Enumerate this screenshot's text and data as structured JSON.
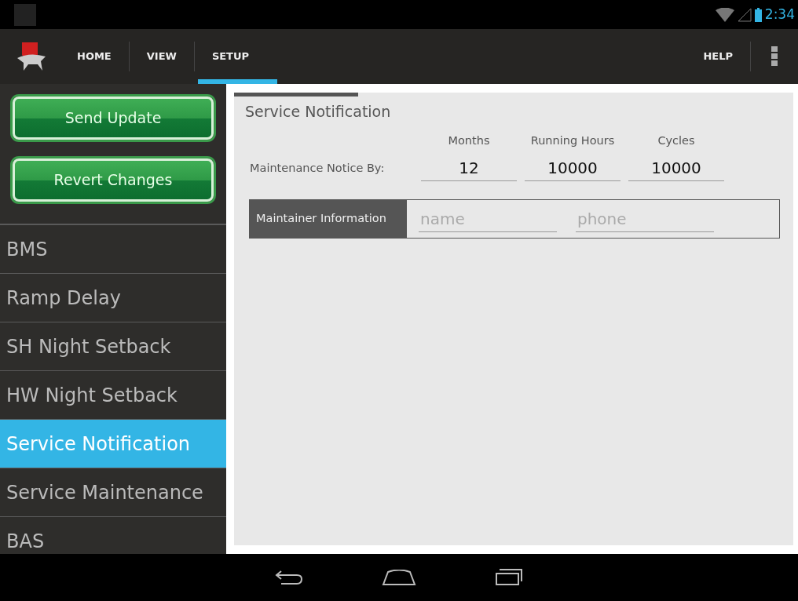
{
  "status_bar": {
    "time": "2:34"
  },
  "action_bar": {
    "tabs": [
      {
        "label": "HOME",
        "selected": false
      },
      {
        "label": "VIEW",
        "selected": false
      },
      {
        "label": "SETUP",
        "selected": true
      }
    ],
    "help": "HELP"
  },
  "sidebar": {
    "buttons": [
      "Send Update",
      "Revert Changes"
    ],
    "items": [
      {
        "label": "BMS",
        "selected": false
      },
      {
        "label": "Ramp Delay",
        "selected": false
      },
      {
        "label": "SH Night Setback",
        "selected": false
      },
      {
        "label": "HW Night Setback",
        "selected": false
      },
      {
        "label": "Service Notification",
        "selected": true
      },
      {
        "label": "Service Maintenance",
        "selected": false
      },
      {
        "label": "BAS",
        "selected": false
      }
    ]
  },
  "panel": {
    "title": "Service Notification",
    "row_label": "Maintenance Notice By:",
    "fields": [
      {
        "label": "Months",
        "value": "12"
      },
      {
        "label": "Running Hours",
        "value": "10000"
      },
      {
        "label": "Cycles",
        "value": "10000"
      }
    ],
    "maintainer": {
      "label": "Maintainer Information",
      "fields": [
        {
          "placeholder": "name"
        },
        {
          "placeholder": "phone"
        }
      ]
    }
  }
}
